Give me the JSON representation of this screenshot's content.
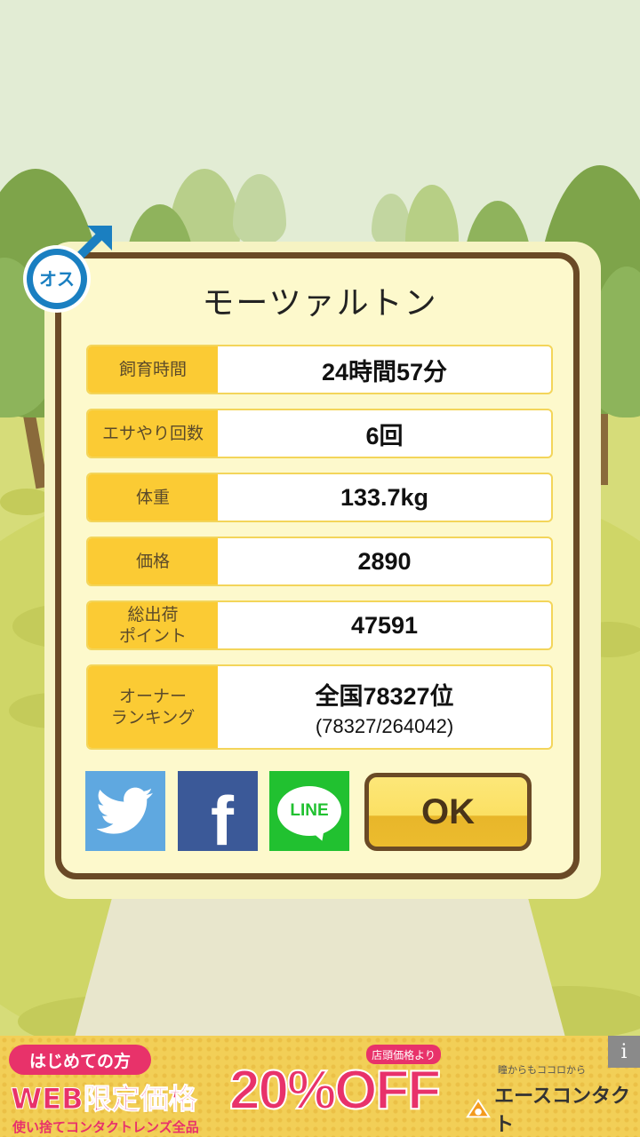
{
  "pet": {
    "name": "モーツァルトン",
    "gender_badge": "オス"
  },
  "stats": [
    {
      "label": "飼育時間",
      "value": "24時間57分"
    },
    {
      "label": "エサやり回数",
      "value": "6回"
    },
    {
      "label": "体重",
      "value": "133.7kg"
    },
    {
      "label": "価格",
      "value": "2890"
    },
    {
      "label": "総出荷\nポイント",
      "value": "47591"
    },
    {
      "label": "オーナー\nランキング",
      "value": "全国78327位",
      "detail": "(78327/264042)"
    }
  ],
  "share": {
    "twitter": "Twitter",
    "facebook": "f",
    "line": "LINE"
  },
  "ok_button": "OK",
  "ad": {
    "tag": "はじめての方",
    "headline": "WEB限定価格",
    "subline": "使い捨てコンタクトレンズ全品",
    "price_note": "店頭価格より",
    "discount": "20%OFF",
    "brand_tagline": "瞳からもココロから",
    "brand": "エースコンタクト",
    "info": "i"
  },
  "colors": {
    "label_bg": "#fbcb34",
    "dialog_border": "#6a4a26",
    "dialog_bg": "#fdf9cc",
    "twitter": "#5fa8e0",
    "facebook": "#3b5998",
    "line": "#21c130",
    "badge": "#1a7fc1",
    "ad_accent": "#e8326a"
  }
}
